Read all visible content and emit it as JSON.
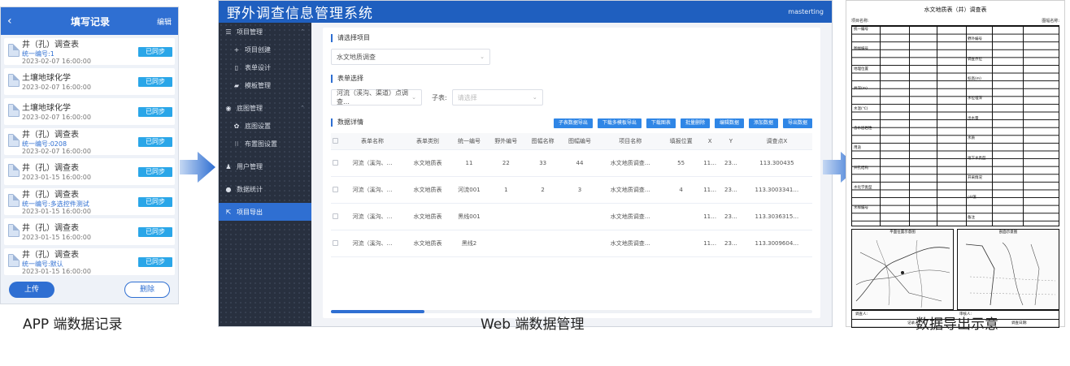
{
  "captions": {
    "app": "APP 端数据记录",
    "web": "Web 端数据管理",
    "export": "数据导出示意"
  },
  "app": {
    "header": {
      "back_icon": "‹",
      "title": "填写记录",
      "edit": "编辑"
    },
    "records": [
      {
        "title": "井（孔）调查表",
        "code": "统一编号:1",
        "time": "2023-02-07 16:00:00",
        "status": "已同步"
      },
      {
        "title": "土壤地球化学",
        "code": "",
        "time": "2023-02-07 16:00:00",
        "status": "已同步"
      },
      {
        "title": "土壤地球化学",
        "code": "",
        "time": "2023-02-07 16:00:00",
        "status": "已同步"
      },
      {
        "title": "井（孔）调查表",
        "code": "统一编号:0208",
        "time": "2023-02-07 16:00:00",
        "status": "已同步"
      },
      {
        "title": "井（孔）调查表",
        "code": "",
        "time": "2023-01-15 16:00:00",
        "status": "已同步"
      },
      {
        "title": "井（孔）调查表",
        "code": "统一编号:多选控件测试",
        "time": "2023-01-15 16:00:00",
        "status": "已同步"
      },
      {
        "title": "井（孔）调查表",
        "code": "",
        "time": "2023-01-15 16:00:00",
        "status": "已同步"
      },
      {
        "title": "井（孔）调查表",
        "code": "统一编号:默认",
        "time": "2023-01-15 16:00:00",
        "status": "已同步"
      }
    ],
    "footer": {
      "upload": "上传",
      "delete": "删除"
    }
  },
  "web": {
    "brand": "野外调查信息管理系统",
    "user": "masterting",
    "sidebar": [
      {
        "icon": "☰",
        "label": "项目管理",
        "sub": false,
        "active": false,
        "caret": "⌃"
      },
      {
        "icon": "+",
        "label": "项目创建",
        "sub": true,
        "active": false,
        "caret": ""
      },
      {
        "icon": "▯",
        "label": "表单设计",
        "sub": true,
        "active": false,
        "caret": ""
      },
      {
        "icon": "▰",
        "label": "模板管理",
        "sub": true,
        "active": false,
        "caret": ""
      },
      {
        "icon": "◉",
        "label": "底图管理",
        "sub": false,
        "active": false,
        "caret": "⌃"
      },
      {
        "icon": "✿",
        "label": "底图设置",
        "sub": true,
        "active": false,
        "caret": ""
      },
      {
        "icon": "⁝⁝",
        "label": "布置图设置",
        "sub": true,
        "active": false,
        "caret": ""
      },
      {
        "icon": "♟",
        "label": "用户管理",
        "sub": false,
        "active": false,
        "caret": ""
      },
      {
        "icon": "●",
        "label": "数据统计",
        "sub": false,
        "active": false,
        "caret": ""
      },
      {
        "icon": "⇱",
        "label": "项目导出",
        "sub": false,
        "active": true,
        "caret": ""
      }
    ],
    "section_project": "请选择项目",
    "project_select": "水文地质调查",
    "section_form": "表单选择",
    "form_select": "河流（溪沟、渠道）点调查…",
    "child_label": "子表:",
    "child_placeholder": "请选择",
    "section_data": "数据详情",
    "buttons": [
      "子表数据导出",
      "下载多模板导出",
      "下载图表",
      "批量删除",
      "编辑数据",
      "添加数据",
      "导出数据"
    ],
    "columns": [
      "",
      "表单名称",
      "表单类别",
      "统一编号",
      "野外编号",
      "图幅名称",
      "图幅编号",
      "项目名称",
      "填报位置",
      "X",
      "Y",
      "调查点X"
    ],
    "rows": [
      [
        "河流（溪沟、…",
        "水文地质表",
        "11",
        "22",
        "33",
        "44",
        "水文地质调查…",
        "55",
        "11…",
        "23…",
        "113.300435"
      ],
      [
        "河流（溪沟、…",
        "水文地质表",
        "河流001",
        "1",
        "2",
        "3",
        "水文地质调查…",
        "4",
        "11…",
        "23…",
        "113.3003341…"
      ],
      [
        "河流（溪沟、…",
        "水文地质表",
        "黑线001",
        "",
        "",
        "",
        "水文地质调查…",
        "",
        "11…",
        "23…",
        "113.3036315…"
      ],
      [
        "河流（溪沟、…",
        "水文地质表",
        "黑线2",
        "",
        "",
        "",
        "水文地质调查…",
        "",
        "11…",
        "23…",
        "113.3009604…"
      ]
    ]
  },
  "export_doc": {
    "title": "水文地质表（井）调查表",
    "sub_left": "项目名称:",
    "sub_right": "图幅名称:",
    "cells": [
      "统一编号",
      "野外编号",
      "图幅编号",
      "调查点位",
      "地理位置",
      "标高(m)",
      "井深(m)",
      "水位埋深",
      "水温(℃)",
      "出水量",
      "含水层岩性",
      "水质",
      "用途",
      "地下水类型",
      "井孔结构",
      "开采情况",
      "水化学类型",
      "pH值",
      "水样编号",
      "备注"
    ],
    "map_left_title": "平面位置示意图",
    "map_right_title": "剖面示意图",
    "foot": [
      "调查人:",
      "记录人:",
      "审核人:",
      "调查日期:"
    ]
  }
}
